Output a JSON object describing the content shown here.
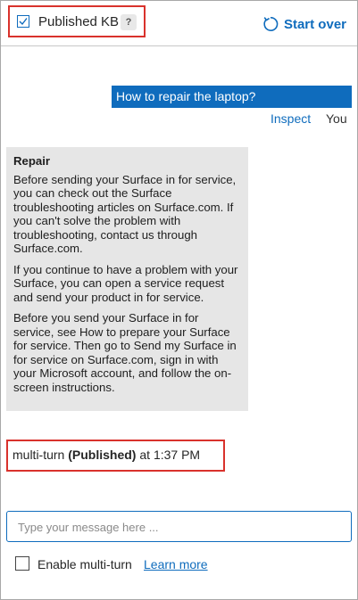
{
  "header": {
    "published_kb_label": "Published KB",
    "published_kb_checked": true,
    "help_badge": "?",
    "start_over_label": "Start over"
  },
  "conversation": {
    "user_message": "How to repair the laptop?",
    "inspect_label": "Inspect",
    "you_label": "You",
    "bot_message": {
      "title": "Repair",
      "paragraphs": [
        "Before sending your Surface in for service, you can check out the Surface troubleshooting articles on Surface.com. If you can't solve the problem with troubleshooting, contact us through Surface.com.",
        "If you continue to have a problem with your Surface, you can open a service request and send your product in for service.",
        "Before you send your Surface in for service, see How to prepare your Surface for service. Then go to Send my Surface in for service on Surface.com, sign in with your Microsoft account, and follow the on-screen instructions."
      ]
    },
    "meta": {
      "prefix": "multi-turn",
      "status": "(Published)",
      "time": "at 1:37 PM"
    }
  },
  "composer": {
    "placeholder": "Type your message here ..."
  },
  "footer": {
    "multi_turn_label": "Enable multi-turn",
    "multi_turn_checked": false,
    "learn_more_label": "Learn more"
  },
  "colors": {
    "accent": "#0f6cbd",
    "highlight": "#d9322c",
    "bot_bubble": "#e6e6e6"
  }
}
